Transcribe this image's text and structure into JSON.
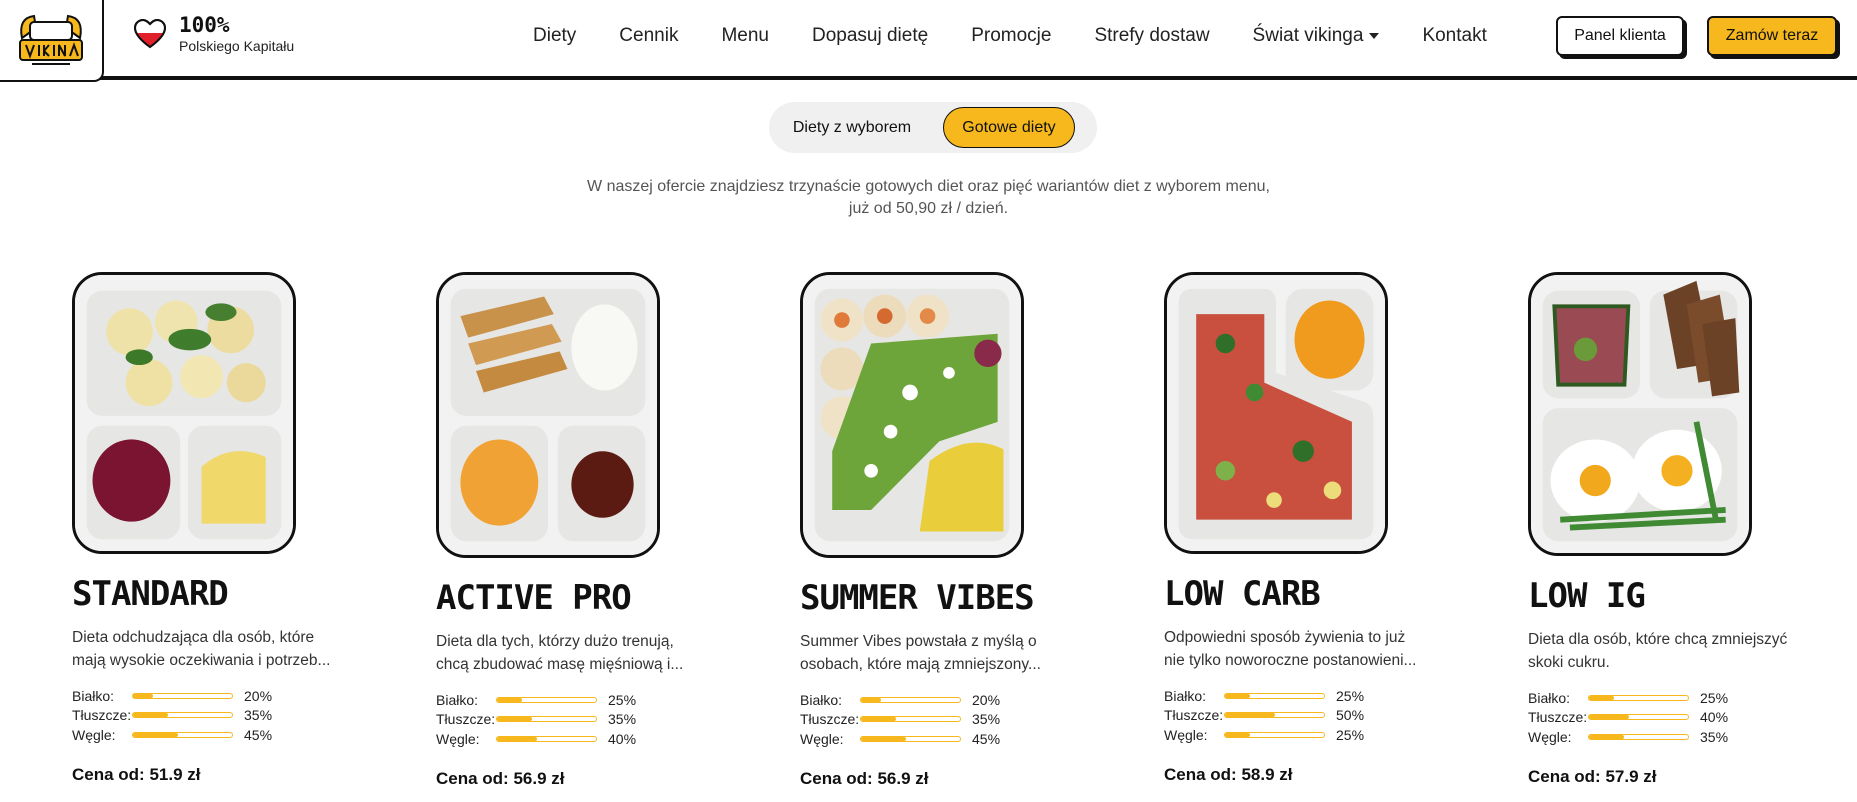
{
  "header": {
    "capital_pct": "100%",
    "capital_sub": "Polskiego Kapitału",
    "nav": [
      "Diety",
      "Cennik",
      "Menu",
      "Dopasuj dietę",
      "Promocje",
      "Strefy dostaw",
      "Świat vikinga",
      "Kontakt"
    ],
    "panel_label": "Panel klienta",
    "order_label": "Zamów teraz"
  },
  "toggle": {
    "option_1": "Diety z wyborem",
    "option_2": "Gotowe diety",
    "selected": "Gotowe diety"
  },
  "intro": {
    "line_1": "W naszej ofercie znajdziesz trzynaście gotowych diet oraz pięć wariantów diet z wyborem menu,",
    "line_2": "już od 50,90 zł / dzień."
  },
  "macro_labels": {
    "protein": "Białko:",
    "fat": "Tłuszcze:",
    "carbs": "Węgle:"
  },
  "diets": [
    {
      "title": "Standard",
      "desc_1": "Dieta odchudzająca dla osób, które",
      "desc_2": "mają wysokie oczekiwania i potrzeb...",
      "protein": "20%",
      "fat": "35%",
      "carbs": "45%",
      "price": "Cena od: 51.9 zł"
    },
    {
      "title": "Active Pro",
      "desc_1": "Dieta dla tych, którzy dużo trenują,",
      "desc_2": "chcą zbudować masę mięśniową i...",
      "protein": "25%",
      "fat": "35%",
      "carbs": "40%",
      "price": "Cena od: 56.9 zł"
    },
    {
      "title": "Summer Vibes",
      "desc_1": "Summer Vibes powstała z myślą o",
      "desc_2": "osobach, które mają zmniejszony...",
      "protein": "20%",
      "fat": "35%",
      "carbs": "45%",
      "price": "Cena od: 56.9 zł"
    },
    {
      "title": "Low Carb",
      "desc_1": "Odpowiedni sposób żywienia to już",
      "desc_2": "nie tylko noworoczne postanowieni...",
      "protein": "25%",
      "fat": "50%",
      "carbs": "25%",
      "price": "Cena od: 58.9 zł"
    },
    {
      "title": "Low IG",
      "desc_1": "Dieta dla osób, które chcą zmniejszyć",
      "desc_2": "skoki cukru.",
      "protein": "25%",
      "fat": "40%",
      "carbs": "35%",
      "price": "Cena od: 57.9 zł"
    }
  ],
  "colors": {
    "accent": "#f6b81c",
    "border": "#111111",
    "text_muted": "#555555"
  },
  "icons": {
    "logo": "viking-logo",
    "heart": "heart-flag-icon",
    "caret": "chevron-down-icon"
  }
}
